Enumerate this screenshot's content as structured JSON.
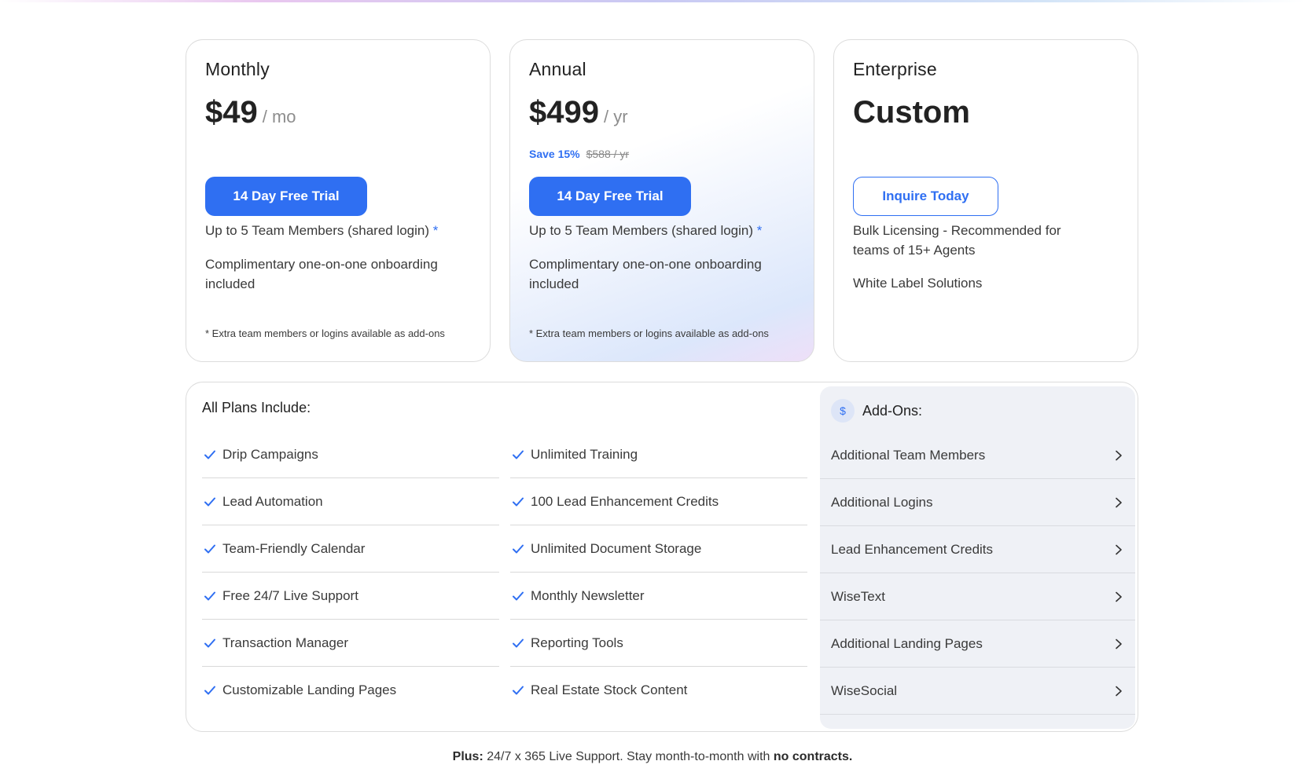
{
  "colors": {
    "accent": "#2f6ff2",
    "text": "#2b2b2b",
    "muted": "#8d8d8d",
    "addons_bg": "#eff1f6"
  },
  "plans": [
    {
      "name": "Monthly",
      "price": "$49",
      "period": "/ mo",
      "button": "14 Day Free Trial",
      "features": [
        "Up to 5 Team Members (shared login)",
        "Complimentary one-on-one onboarding included"
      ],
      "asterisk": "*",
      "footnote": "* Extra team members or logins available as add-ons"
    },
    {
      "name": "Annual",
      "price": "$499",
      "period": "/ yr",
      "save": "Save 15%",
      "old_price": "$588 / yr",
      "button": "14 Day Free Trial",
      "features": [
        "Up to 5 Team Members (shared login)",
        "Complimentary one-on-one onboarding included"
      ],
      "asterisk": "*",
      "footnote": "* Extra team members or logins available as add-ons"
    },
    {
      "name": "Enterprise",
      "price": "Custom",
      "button": "Inquire Today",
      "features": [
        "Bulk Licensing - Recommended for teams of 15+ Agents",
        "White Label Solutions"
      ]
    }
  ],
  "includes": {
    "title": "All Plans Include:",
    "col1": [
      "Drip Campaigns",
      "Lead Automation",
      "Team-Friendly Calendar",
      "Free 24/7 Live Support",
      "Transaction Manager",
      "Customizable Landing Pages"
    ],
    "col2": [
      "Unlimited Training",
      "100 Lead Enhancement Credits",
      "Unlimited Document Storage",
      "Monthly Newsletter",
      "Reporting Tools",
      "Real Estate Stock Content"
    ]
  },
  "addons": {
    "badge": "$",
    "title": "Add-Ons:",
    "items": [
      "Additional Team Members",
      "Additional Logins",
      "Lead Enhancement Credits",
      "WiseText",
      "Additional Landing Pages",
      "WiseSocial"
    ]
  },
  "footer": {
    "plus": "Plus:",
    "middle": " 24/7 x 365 Live Support. Stay month-to-month with ",
    "bold_end": "no contracts."
  },
  "icons": {
    "check": "check-icon",
    "chevron": "chevron-right-icon",
    "dollar": "dollar-icon"
  }
}
